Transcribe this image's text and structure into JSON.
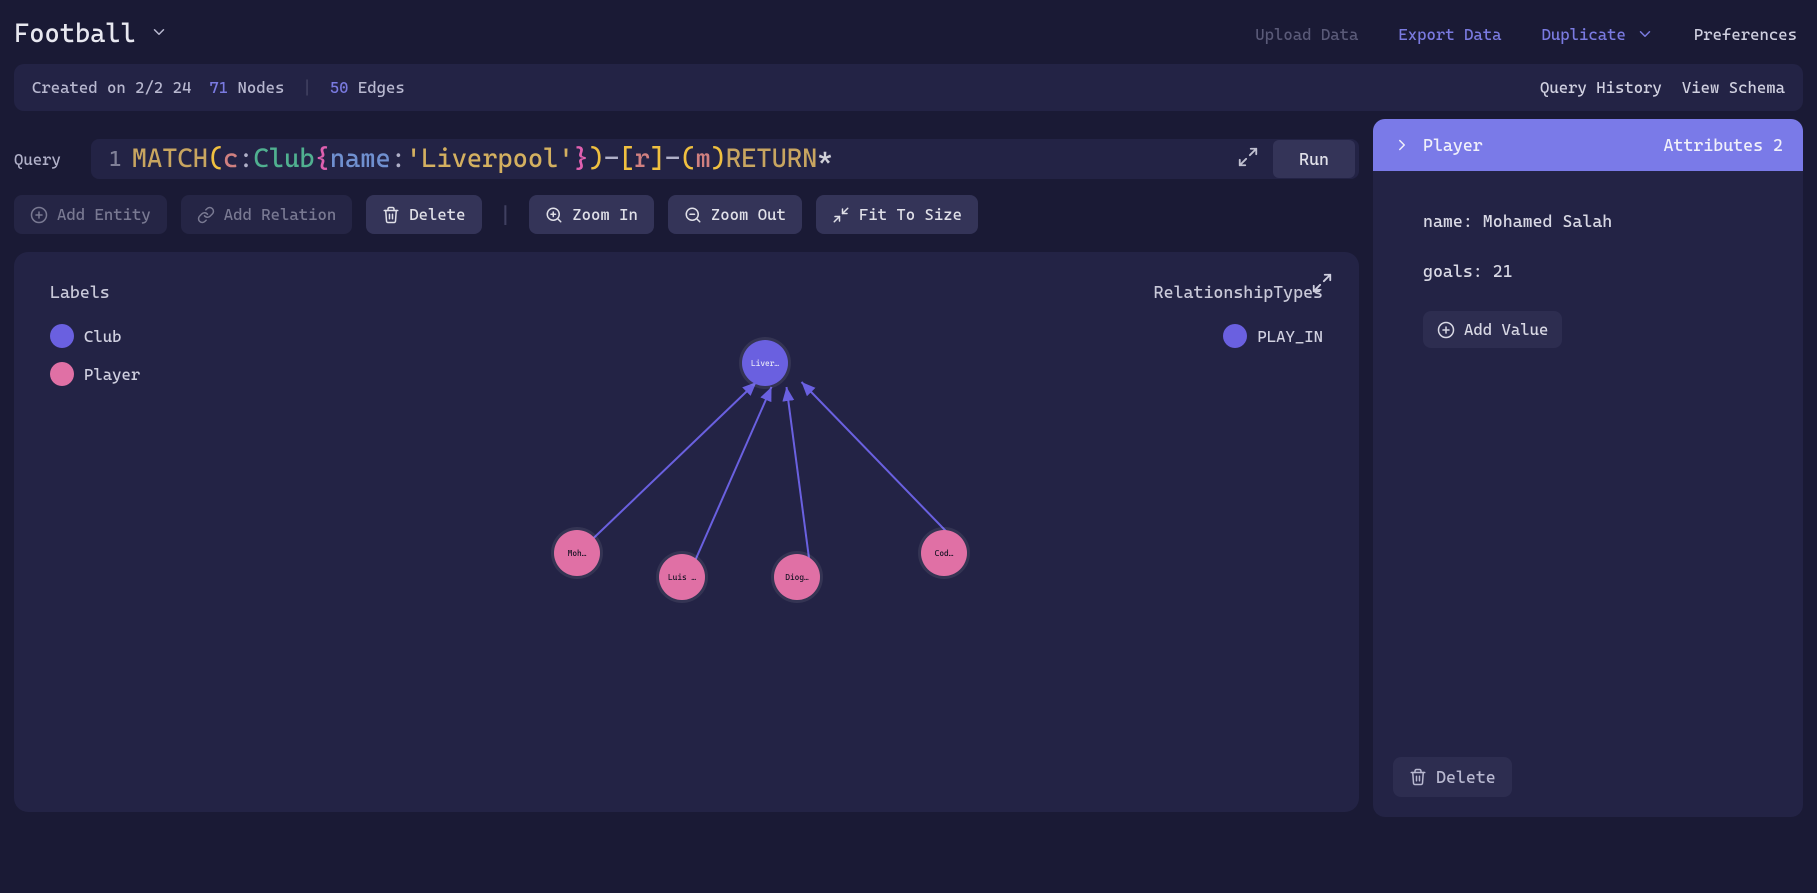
{
  "header": {
    "title": "Football",
    "upload": "Upload Data",
    "export": "Export Data",
    "duplicate": "Duplicate",
    "preferences": "Preferences"
  },
  "meta": {
    "created": "Created on 2/2 24",
    "nodes_count": "71",
    "nodes_label": "Nodes",
    "edges_count": "50",
    "edges_label": "Edges",
    "query_history": "Query History",
    "view_schema": "View Schema"
  },
  "query": {
    "label": "Query",
    "line": "1",
    "tokens": {
      "match": "MATCH ",
      "open_p1": "(",
      "var_c": "c",
      "colon1": ":",
      "type_club": "Club",
      "space1": " ",
      "open_b": "{",
      "prop_name": "name",
      "colon2": ": ",
      "str": "'Liverpool'",
      "close_b": "}",
      "close_p1": ")",
      "dash1": "-",
      "open_sq": "[",
      "var_r": "r",
      "close_sq": "]",
      "dash2": "-",
      "open_p2": "(",
      "var_m": "m",
      "close_p2": ")",
      "space2": " ",
      "return": "RETURN ",
      "star": "*"
    },
    "run": "Run"
  },
  "toolbar": {
    "add_entity": "Add Entity",
    "add_relation": "Add Relation",
    "delete": "Delete",
    "zoom_in": "Zoom In",
    "zoom_out": "Zoom Out",
    "fit": "Fit To Size"
  },
  "canvas": {
    "labels_title": "Labels",
    "club": "Club",
    "player": "Player",
    "rels_title": "RelationshipTypes",
    "play_in": "PLAY_IN",
    "nodes": {
      "liver": "Liver…",
      "moh": "Moh…",
      "luis": "Luis …",
      "diog": "Diog…",
      "cod": "Cod…"
    }
  },
  "side": {
    "type": "Player",
    "attr_label": "Attributes",
    "attr_count": "2",
    "attrs": {
      "name": "name: Mohamed Salah",
      "goals": "goals: 21"
    },
    "add_value": "Add Value",
    "delete": "Delete"
  }
}
